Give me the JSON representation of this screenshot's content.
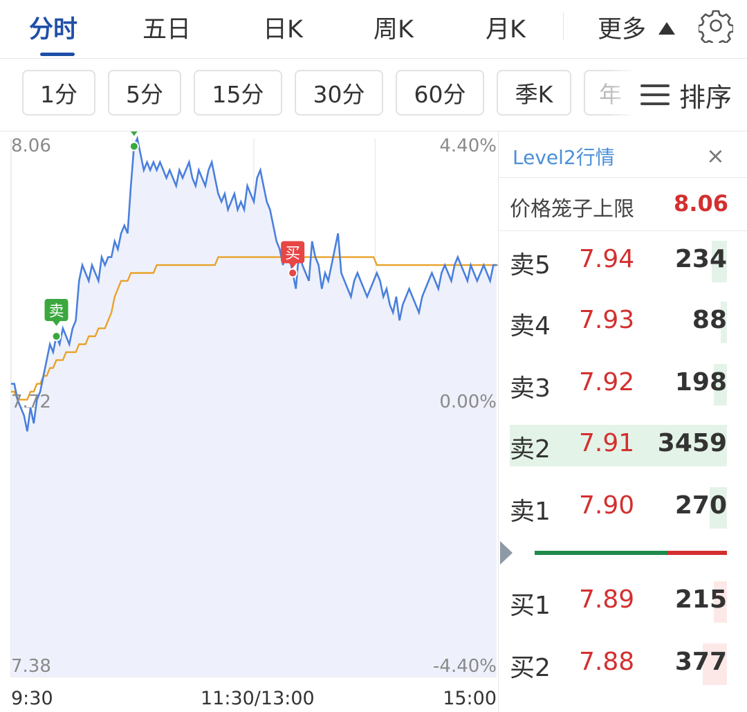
{
  "tabs": [
    {
      "label": "分时",
      "active": true
    },
    {
      "label": "五日"
    },
    {
      "label": "日K"
    },
    {
      "label": "周K"
    },
    {
      "label": "月K"
    },
    {
      "label": "更多"
    }
  ],
  "settings_icon": "gear-icon",
  "periods": [
    "1分",
    "5分",
    "15分",
    "30分",
    "60分",
    "季K",
    "年"
  ],
  "sort": {
    "label": "排序",
    "icon": "menu-icon"
  },
  "chart": {
    "price_max": "8.06",
    "price_mid": "7.72",
    "price_min": "7.38",
    "pct_max": "4.40%",
    "pct_mid": "0.00%",
    "pct_min": "-4.40%",
    "time_start": "9:30",
    "time_mid": "11:30/13:00",
    "time_end": "15:00",
    "markers": [
      {
        "label": "卖",
        "type": "sell"
      },
      {
        "label": "卖",
        "type": "sell"
      },
      {
        "label": "买",
        "type": "buy"
      }
    ]
  },
  "chart_data": {
    "type": "line",
    "ylim": [
      7.38,
      8.06
    ],
    "pct_range": [
      "-4.40%",
      "4.40%"
    ],
    "x_ticks": [
      "9:30",
      "11:30/13:00",
      "15:00"
    ],
    "y_ticks": [
      "8.06",
      "7.72",
      "7.38"
    ],
    "baseline": 7.72,
    "grid": true,
    "colors": {
      "price": "#4a7fdc",
      "avg": "#e8a228",
      "fill": "#eef1fb",
      "sell": "#3aa83f",
      "buy": "#e84545"
    },
    "series": [
      {
        "values": [
          7.75,
          7.75,
          7.73,
          7.72,
          7.71,
          7.69,
          7.72,
          7.7,
          7.73,
          7.74,
          7.76,
          7.78,
          7.8,
          7.79,
          7.81,
          7.8,
          7.82,
          7.81,
          7.8,
          7.82,
          7.83,
          7.88,
          7.9,
          7.89,
          7.88,
          7.9,
          7.89,
          7.88,
          7.91,
          7.9,
          7.91,
          7.91,
          7.93,
          7.92,
          7.94,
          7.95,
          7.94,
          8.0,
          8.05,
          8.06,
          8.04,
          8.02,
          8.03,
          8.02,
          8.03,
          8.02,
          8.03,
          8.02,
          8.01,
          8.02,
          8.01,
          8.0,
          8.02,
          8.01,
          8.02,
          8.03,
          8.01,
          8.0,
          8.02,
          8.01,
          8.0,
          8.02,
          8.03,
          8.01,
          7.99,
          7.98,
          7.99,
          7.97,
          7.98,
          7.99,
          7.97,
          7.98,
          7.97,
          8.0,
          7.99,
          7.98,
          8.01,
          8.02,
          8.0,
          7.98,
          7.97,
          7.95,
          7.93,
          7.92,
          7.9,
          7.92,
          7.91,
          7.89,
          7.87,
          7.92,
          7.9,
          7.89,
          7.88,
          7.93,
          7.91,
          7.9,
          7.87,
          7.89,
          7.88,
          7.9,
          7.92,
          7.94,
          7.89,
          7.88,
          7.87,
          7.86,
          7.88,
          7.89,
          7.88,
          7.87,
          7.86,
          7.87,
          7.88,
          7.89,
          7.88,
          7.86,
          7.87,
          7.85,
          7.84,
          7.86,
          7.83,
          7.85,
          7.86,
          7.87,
          7.86,
          7.85,
          7.84,
          7.86,
          7.87,
          7.88,
          7.89,
          7.88,
          7.87,
          7.89,
          7.9,
          7.89,
          7.88,
          7.9,
          7.91,
          7.9,
          7.89,
          7.88,
          7.9,
          7.89,
          7.88,
          7.89,
          7.9,
          7.89,
          7.88,
          7.9,
          7.9
        ]
      },
      {
        "values": [
          7.74,
          7.74,
          7.73,
          7.73,
          7.73,
          7.73,
          7.74,
          7.74,
          7.75,
          7.75,
          7.76,
          7.76,
          7.77,
          7.77,
          7.78,
          7.78,
          7.78,
          7.79,
          7.79,
          7.79,
          7.79,
          7.8,
          7.8,
          7.8,
          7.81,
          7.81,
          7.81,
          7.82,
          7.82,
          7.82,
          7.83,
          7.84,
          7.86,
          7.87,
          7.88,
          7.88,
          7.88,
          7.89,
          7.89,
          7.89,
          7.89,
          7.89,
          7.89,
          7.89,
          7.89,
          7.9,
          7.9,
          7.9,
          7.9,
          7.9,
          7.9,
          7.9,
          7.9,
          7.9,
          7.9,
          7.9,
          7.9,
          7.9,
          7.9,
          7.9,
          7.9,
          7.9,
          7.9,
          7.9,
          7.91,
          7.91,
          7.91,
          7.91,
          7.91,
          7.91,
          7.91,
          7.91,
          7.91,
          7.91,
          7.91,
          7.91,
          7.91,
          7.91,
          7.91,
          7.91,
          7.91,
          7.91,
          7.91,
          7.91,
          7.91,
          7.91,
          7.91,
          7.91,
          7.91,
          7.91,
          7.91,
          7.91,
          7.91,
          7.91,
          7.91,
          7.91,
          7.91,
          7.91,
          7.91,
          7.91,
          7.91,
          7.91,
          7.91,
          7.91,
          7.91,
          7.91,
          7.91,
          7.91,
          7.91,
          7.91,
          7.91,
          7.91,
          7.91,
          7.9,
          7.9,
          7.9,
          7.9,
          7.9,
          7.9,
          7.9,
          7.9,
          7.9,
          7.9,
          7.9,
          7.9,
          7.9,
          7.9,
          7.9,
          7.9,
          7.9,
          7.9,
          7.9,
          7.9,
          7.9,
          7.9,
          7.9,
          7.9,
          7.9,
          7.9,
          7.9,
          7.9,
          7.9,
          7.9,
          7.9,
          7.9,
          7.9,
          7.9,
          7.9,
          7.9,
          7.9,
          7.9,
          7.9
        ]
      }
    ]
  },
  "level2": {
    "title": "Level2行情",
    "close": "×",
    "limit_label": "价格笼子上限",
    "limit_value": "8.06",
    "asks": [
      {
        "label": "卖5",
        "price": "7.94",
        "vol": "234",
        "bar": 0.07
      },
      {
        "label": "卖4",
        "price": "7.93",
        "vol": "88",
        "bar": 0.03
      },
      {
        "label": "卖3",
        "price": "7.92",
        "vol": "198",
        "bar": 0.06
      },
      {
        "label": "卖2",
        "price": "7.91",
        "vol": "3459",
        "bar": 1.0
      },
      {
        "label": "卖1",
        "price": "7.90",
        "vol": "270",
        "bar": 0.08
      }
    ],
    "split": {
      "sell_share": 0.69,
      "buy_share": 0.31,
      "sell_color": "#1f8a4c",
      "buy_color": "#d32f2f"
    },
    "bids": [
      {
        "label": "买1",
        "price": "7.89",
        "vol": "215",
        "bar": 0.06
      },
      {
        "label": "买2",
        "price": "7.88",
        "vol": "377",
        "bar": 0.11
      }
    ]
  }
}
